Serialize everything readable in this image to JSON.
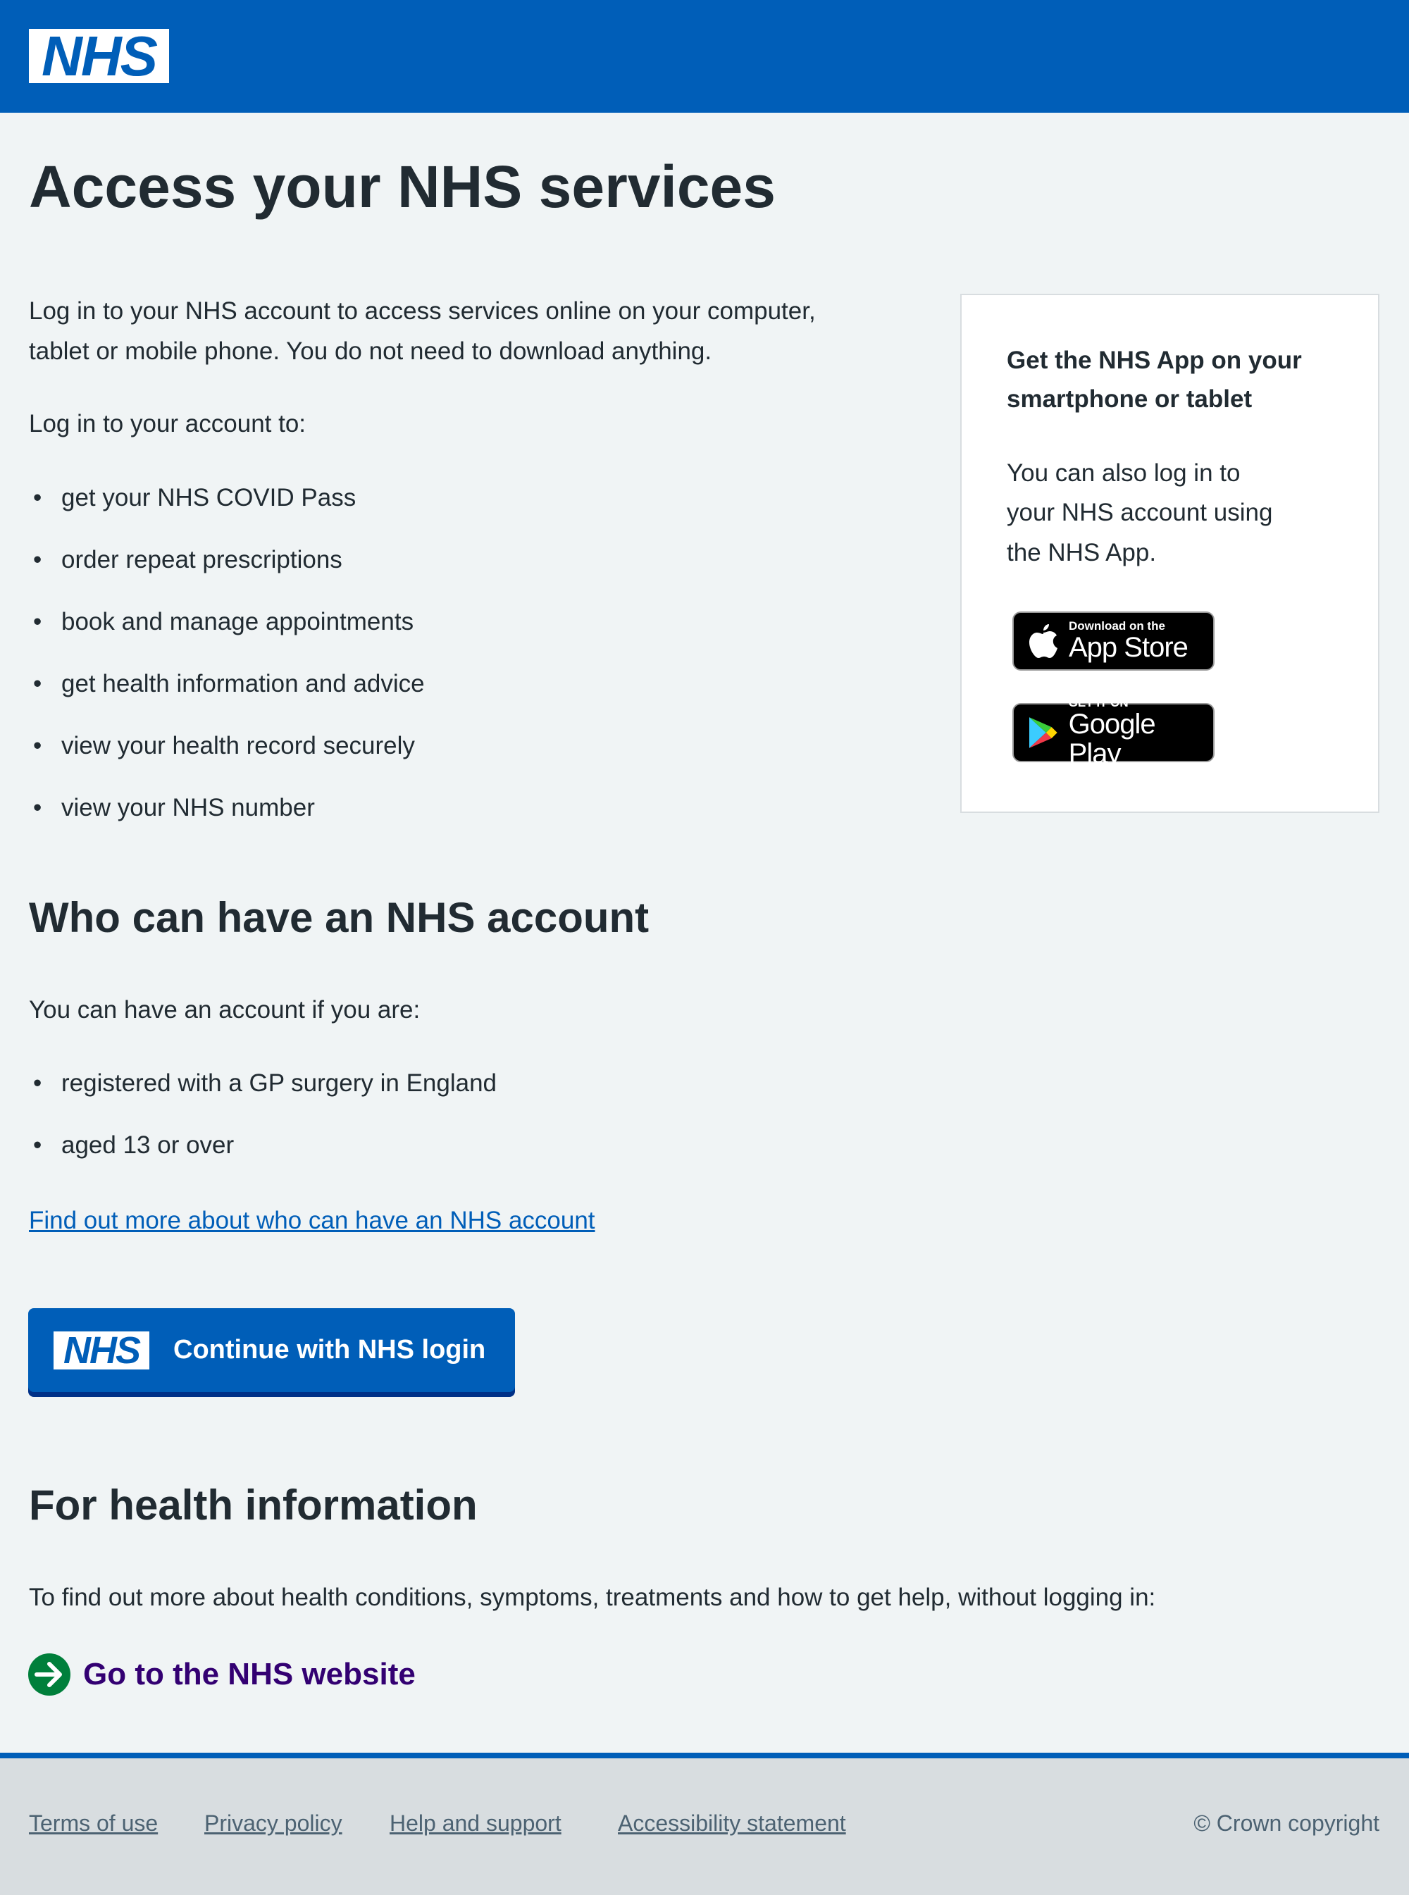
{
  "header": {
    "logo": "NHS",
    "brand_color": "#005eb8"
  },
  "main": {
    "title": "Access your NHS services",
    "intro": [
      "Log in to your NHS account to access services online on your computer,",
      "tablet or mobile phone. You do not need to download anything."
    ],
    "list_intro": "Log in to your account to:",
    "services": [
      "get your NHS COVID Pass",
      "order repeat prescriptions",
      "book and manage appointments",
      "get health information and advice",
      "view your health record securely",
      "view your NHS number"
    ],
    "who_heading": "Who can have an NHS account",
    "who_intro": "You can have an account if you are:",
    "who_list": [
      "registered with a GP surgery in England",
      "aged 13 or over"
    ],
    "who_link": "Find out more about who can have an NHS account",
    "login_button": {
      "logo": "NHS",
      "label": "Continue with NHS login"
    },
    "health_heading": "For health information",
    "health_text": "To find out more about health conditions, symptoms, treatments and how to get help, without logging in:",
    "health_link": "Go to the NHS website"
  },
  "panel": {
    "heading": [
      "Get the NHS App on your",
      "smartphone or tablet"
    ],
    "text": [
      "You can also log in to",
      "your NHS account using",
      "the NHS App."
    ],
    "app_store": {
      "small": "Download on the",
      "big": "App Store"
    },
    "google_play": {
      "small": "GET IT ON",
      "big": "Google Play"
    }
  },
  "footer": {
    "links": [
      "Terms of use",
      "Privacy policy",
      "Help and support",
      "Accessibility statement"
    ],
    "copyright": "© Crown copyright"
  }
}
